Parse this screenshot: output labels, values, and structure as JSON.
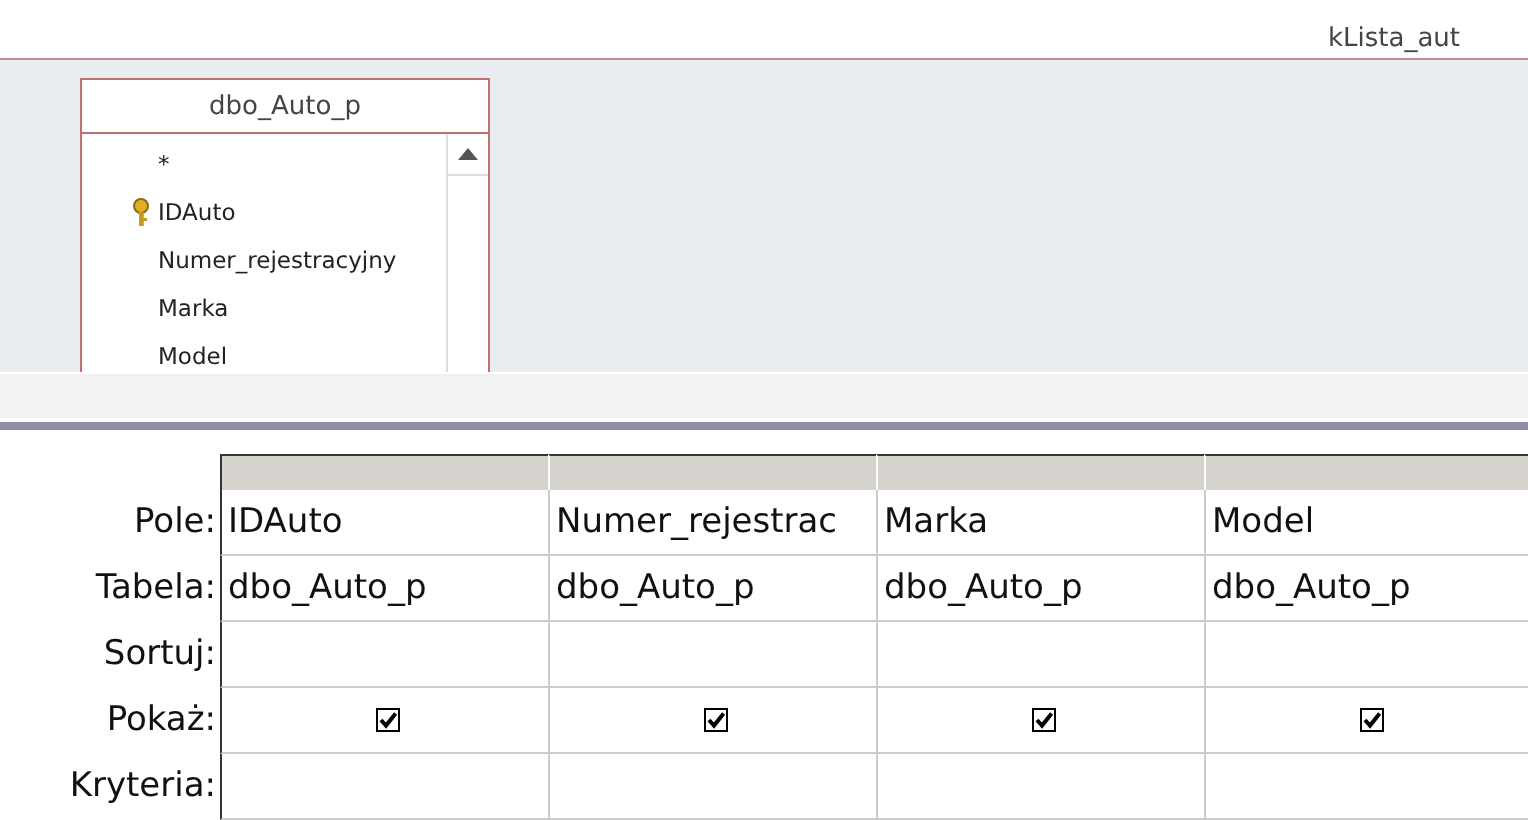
{
  "query_title": "kLista_aut",
  "table": {
    "title": "dbo_Auto_p",
    "fields": [
      {
        "name": "*",
        "primary_key": false
      },
      {
        "name": "IDAuto",
        "primary_key": true
      },
      {
        "name": "Numer_rejestracyjny",
        "primary_key": false
      },
      {
        "name": "Marka",
        "primary_key": false
      },
      {
        "name": "Model",
        "primary_key": false
      }
    ]
  },
  "grid": {
    "row_labels": [
      "Pole:",
      "Tabela:",
      "Sortuj:",
      "Pokaż:",
      "Kryteria:"
    ],
    "columns": [
      {
        "field": "IDAuto",
        "table": "dbo_Auto_p",
        "show": true
      },
      {
        "field": "Numer_rejestrac",
        "table": "dbo_Auto_p",
        "show": true
      },
      {
        "field": "Marka",
        "table": "dbo_Auto_p",
        "show": true
      },
      {
        "field": "Model",
        "table": "dbo_Auto_p",
        "show": true
      }
    ]
  }
}
